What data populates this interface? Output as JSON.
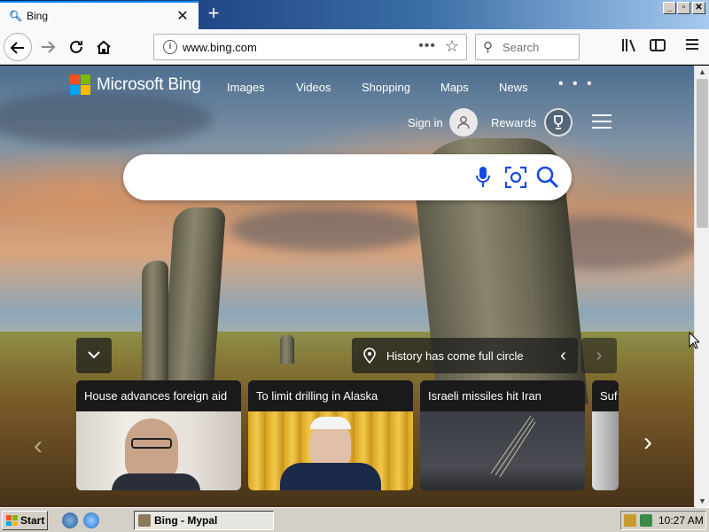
{
  "browser": {
    "tab_title": "Bing",
    "tab_close": "✕",
    "new_tab": "+",
    "url": "www.bing.com",
    "url_more": "•••",
    "search_placeholder": "Search"
  },
  "window_controls": {
    "minimize": "_",
    "maximize": "▫",
    "close": "✕"
  },
  "bing": {
    "brand": "Microsoft Bing",
    "nav": [
      "Images",
      "Videos",
      "Shopping",
      "Maps",
      "News"
    ],
    "more": "• • •",
    "sign_in": "Sign in",
    "rewards": "Rewards",
    "image_caption": "History has come full circle",
    "news": [
      {
        "title": "House advances foreign aid"
      },
      {
        "title": "To limit drilling in Alaska"
      },
      {
        "title": "Israeli missiles hit Iran"
      },
      {
        "title": "Suf"
      }
    ]
  },
  "colors": {
    "ms_red": "#f25022",
    "ms_green": "#7fba00",
    "ms_blue": "#00a4ef",
    "ms_yellow": "#ffb900",
    "bing_blue": "#174ae4",
    "firefox_blue": "#0a84ff"
  },
  "taskbar": {
    "start": "Start",
    "task": "Bing - Mypal",
    "clock": "10:27 AM"
  },
  "icons": [
    "back-icon",
    "forward-icon",
    "reload-icon",
    "home-icon",
    "info-icon",
    "star-icon",
    "library-icon",
    "sidebar-icon",
    "menu-icon",
    "mic-icon",
    "visual-search-icon",
    "search-icon",
    "pin-icon",
    "trophy-icon",
    "user-icon"
  ]
}
